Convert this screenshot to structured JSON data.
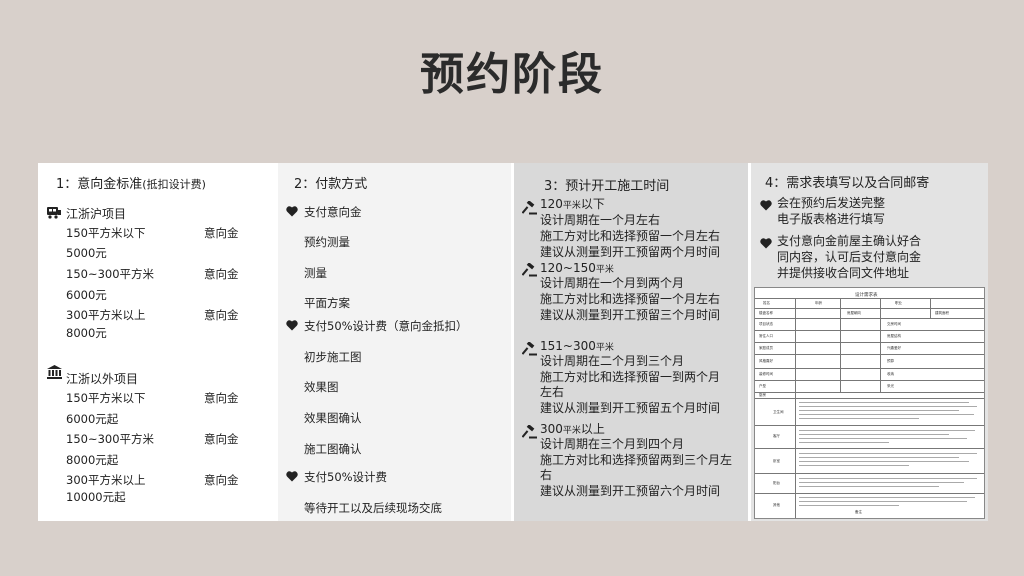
{
  "title": "预约阶段",
  "columns": [
    {
      "header": "1：意向金标准",
      "header_note": "(抵扣设计费)",
      "groups": [
        {
          "icon": "train-icon",
          "name": "江浙沪项目",
          "rows": [
            {
              "area": "150平方米以下",
              "label": "意向金",
              "amount": "5000元"
            },
            {
              "area": "150~300平方米",
              "label": "意向金",
              "amount": "6000元"
            },
            {
              "area": "300平方米以上",
              "label": "意向金",
              "amount": "8000元"
            }
          ]
        },
        {
          "icon": "bank-icon",
          "name": "江浙以外项目",
          "rows": [
            {
              "area": "150平方米以下",
              "label": "意向金",
              "amount": "6000元起"
            },
            {
              "area": "150~300平方米",
              "label": "意向金",
              "amount": "8000元起"
            },
            {
              "area": "300平方米以上",
              "label": "意向金",
              "amount": "10000元起"
            }
          ]
        }
      ]
    },
    {
      "header": "2：付款方式",
      "steps": [
        {
          "pay": "支付意向金",
          "items": [
            "预约测量",
            "测量",
            "平面方案"
          ]
        },
        {
          "pay": "支付50%设计费（意向金抵扣）",
          "items": [
            "初步施工图",
            "效果图",
            "效果图确认",
            "施工图确认"
          ]
        },
        {
          "pay": "支付50%设计费",
          "items": [
            "等待开工以及后续现场交底"
          ]
        }
      ]
    },
    {
      "header": "3：预计开工施工时间",
      "blocks": [
        {
          "range": "120",
          "unit": "平米",
          "suffix": "以下",
          "lines": [
            "设计周期在一个月左右",
            "施工方对比和选择预留一个月左右",
            "建议从测量到开工预留两个月时间"
          ]
        },
        {
          "range": "120~150",
          "unit": "平米",
          "suffix": "",
          "lines": [
            "设计周期在一个月到两个月",
            "施工方对比和选择预留一个月左右",
            "建议从测量到开工预留三个月时间"
          ]
        },
        {
          "range": "151~300",
          "unit": "平米",
          "suffix": "",
          "lines": [
            "设计周期在二个月到三个月",
            "施工方对比和选择预留一到两个月",
            "左右",
            "建议从测量到开工预留五个月时间"
          ]
        },
        {
          "range": "300",
          "unit": "平米",
          "suffix": "以上",
          "lines": [
            "设计周期在三个月到四个月",
            "施工方对比和选择预留两到三个月左",
            "右",
            "建议从测量到开工预留六个月时间"
          ]
        }
      ]
    },
    {
      "header": "4：需求表填写以及合同邮寄",
      "notes": [
        {
          "lines": [
            "会在预约后发送完整",
            "电子版表格进行填写"
          ]
        },
        {
          "lines": [
            "支付意向金前屋主确认好合",
            "同内容，认可后支付意向金",
            "并提供接收合同文件地址"
          ]
        }
      ],
      "form": {
        "title": "设计需求表",
        "cells": [
          "姓名",
          "年龄",
          "职业",
          "楼盘名称",
          "房屋朝向",
          "建筑面积",
          "项目状态",
          "交房时间",
          "常住人口",
          "房屋结构",
          "家庭成员",
          "兴趣爱好",
          "风格喜好",
          "预算",
          "装修时间",
          "收纳",
          "户型",
          "采光",
          "厨房",
          "卫生间",
          "客厅",
          "卧室",
          "阳台",
          "其他",
          "备注"
        ]
      }
    }
  ],
  "colors": {
    "background": "#d8d0cb",
    "panel": "#ffffff",
    "col2": "#f3f3f3",
    "col3": "#d9d9d9",
    "col4": "#e3e3e3",
    "text": "#222222"
  }
}
